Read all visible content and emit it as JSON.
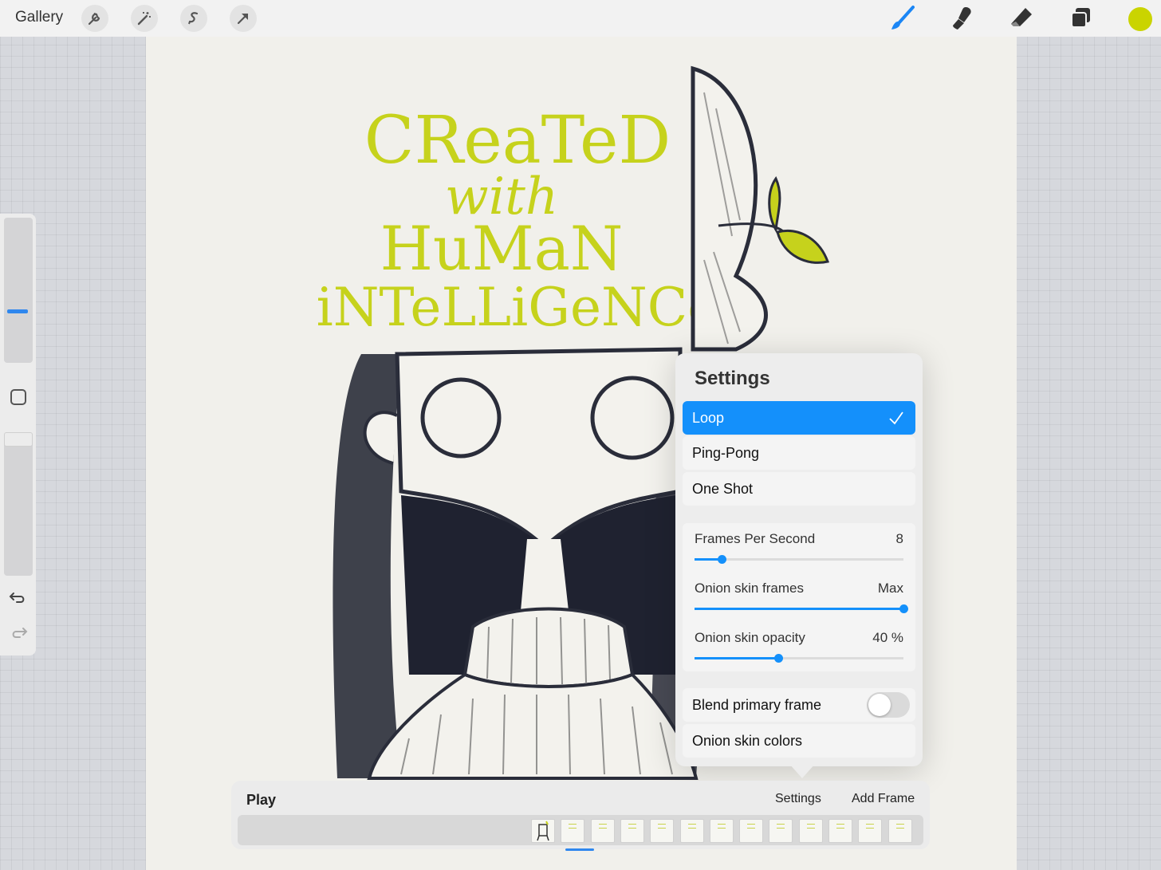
{
  "toolbar": {
    "gallery_label": "Gallery",
    "left_tools": [
      "wrench-icon",
      "magic-wand-icon",
      "selection-icon",
      "transform-arrow-icon"
    ],
    "right_tools": [
      "brush-icon",
      "smudge-icon",
      "eraser-icon",
      "layers-icon"
    ],
    "active_tool": "brush-icon",
    "active_color": "#cad400"
  },
  "artwork": {
    "lettering": [
      "CReaTeD",
      "with",
      "HuMaN",
      "iNTeLLiGeNCe"
    ],
    "lettering_color": "#c6d21c"
  },
  "settings": {
    "title": "Settings",
    "playback_modes": [
      {
        "label": "Loop",
        "selected": true
      },
      {
        "label": "Ping-Pong",
        "selected": false
      },
      {
        "label": "One Shot",
        "selected": false
      }
    ],
    "sliders": [
      {
        "label": "Frames Per Second",
        "value": "8",
        "fraction": 0.13
      },
      {
        "label": "Onion skin frames",
        "value": "Max",
        "fraction": 1.0
      },
      {
        "label": "Onion skin opacity",
        "value": "40 %",
        "fraction": 0.4
      }
    ],
    "blend_primary": {
      "label": "Blend primary frame",
      "on": false
    },
    "onion_colors_label": "Onion skin colors"
  },
  "timeline": {
    "play_label": "Play",
    "settings_label": "Settings",
    "add_frame_label": "Add Frame",
    "frame_count": 13,
    "selected_frame": 1
  },
  "colors": {
    "accent": "#1490fb",
    "brand_green": "#cad400"
  }
}
